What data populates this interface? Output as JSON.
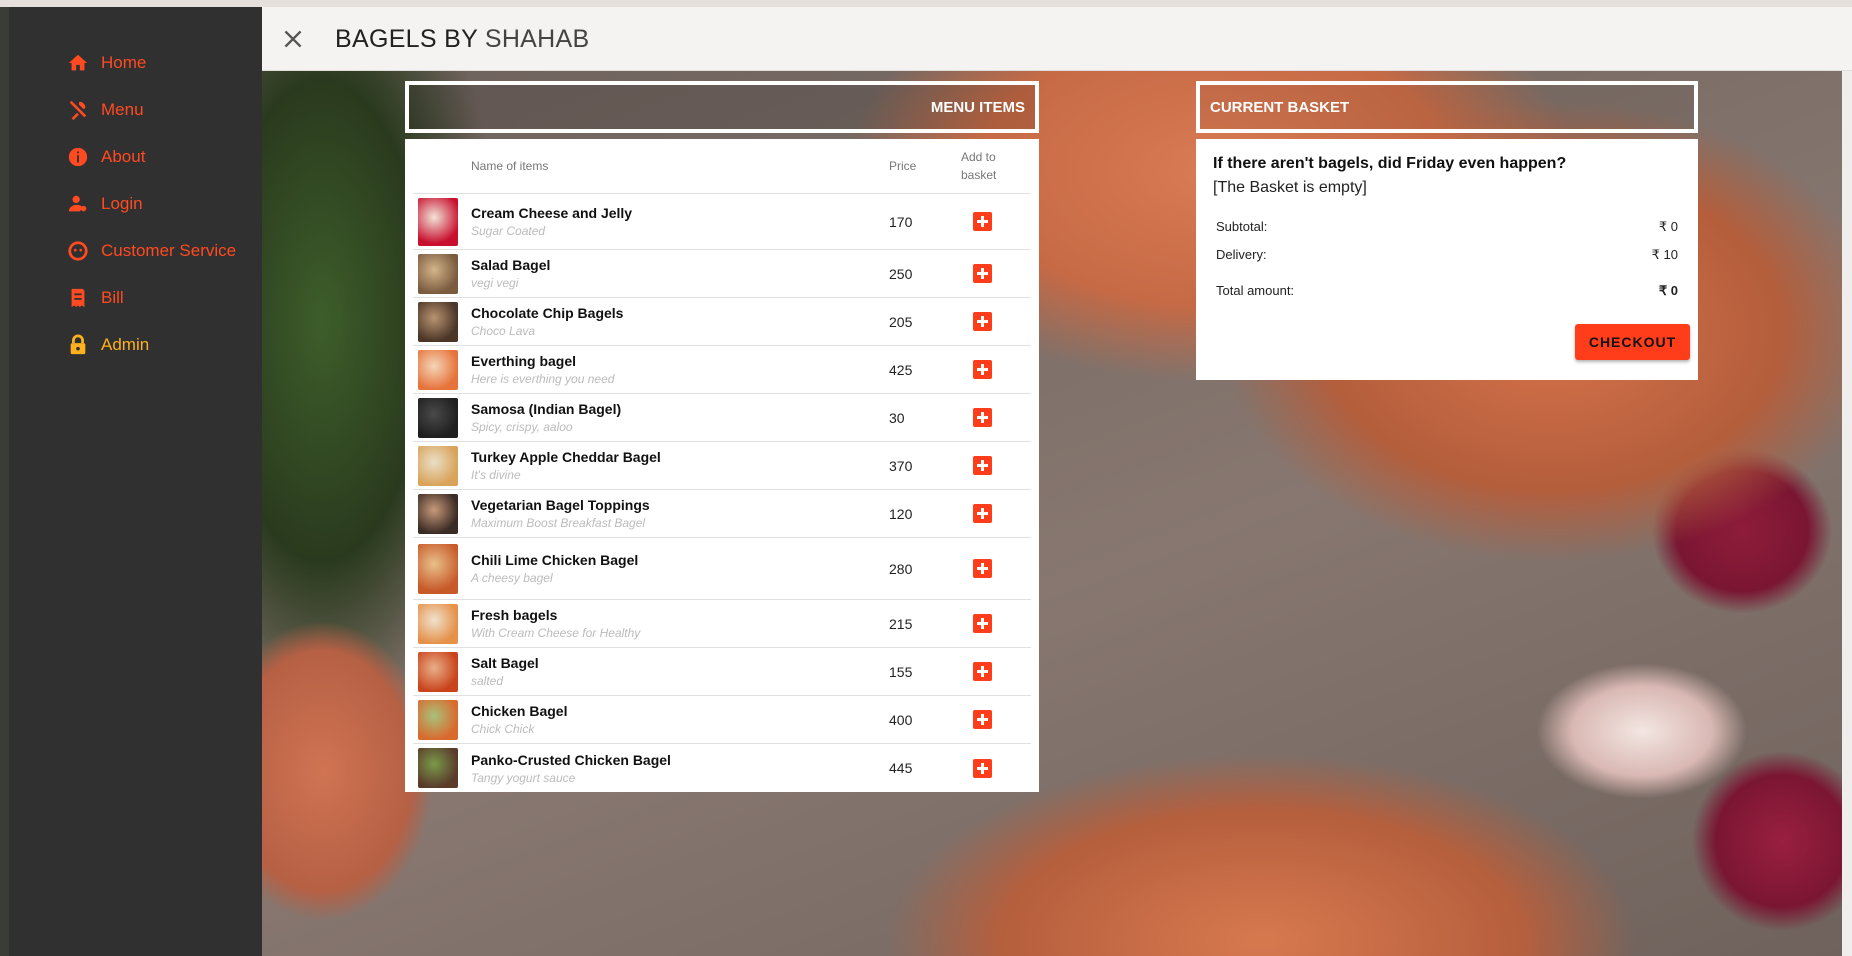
{
  "brand": {
    "part1": "BAGELS BY",
    "part2": "SHAHAB"
  },
  "nav": [
    {
      "label": "Home",
      "icon": "home-icon"
    },
    {
      "label": "Menu",
      "icon": "utensils-icon"
    },
    {
      "label": "About",
      "icon": "info-icon"
    },
    {
      "label": "Login",
      "icon": "user-icon"
    },
    {
      "label": "Customer Service",
      "icon": "headset-icon"
    },
    {
      "label": "Bill",
      "icon": "receipt-icon"
    },
    {
      "label": "Admin",
      "icon": "lock-icon"
    }
  ],
  "menu": {
    "header": "MENU ITEMS",
    "columns": {
      "name": "Name of items",
      "price": "Price",
      "add": "Add to basket"
    },
    "items": [
      {
        "name": "Cream Cheese and Jelly",
        "desc": "Sugar Coated",
        "price": "170"
      },
      {
        "name": "Salad Bagel",
        "desc": "vegi vegi",
        "price": "250"
      },
      {
        "name": "Chocolate Chip Bagels",
        "desc": "Choco Lava",
        "price": "205"
      },
      {
        "name": "Everthing bagel",
        "desc": "Here is everthing you need",
        "price": "425"
      },
      {
        "name": "Samosa (Indian Bagel)",
        "desc": "Spicy, crispy, aaloo",
        "price": "30"
      },
      {
        "name": "Turkey Apple Cheddar Bagel",
        "desc": "It's divine",
        "price": "370"
      },
      {
        "name": "Vegetarian Bagel Toppings",
        "desc": "Maximum Boost Breakfast Bagel",
        "price": "120"
      },
      {
        "name": "Chili Lime Chicken Bagel",
        "desc": "A cheesy bagel",
        "price": "280"
      },
      {
        "name": "Fresh bagels",
        "desc": "With Cream Cheese for Healthy",
        "price": "215"
      },
      {
        "name": "Salt Bagel",
        "desc": "salted",
        "price": "155"
      },
      {
        "name": "Chicken Bagel",
        "desc": "Chick Chick",
        "price": "400"
      },
      {
        "name": "Panko-Crusted Chicken Bagel",
        "desc": "Tangy yogurt sauce",
        "price": "445"
      }
    ]
  },
  "basket": {
    "header": "CURRENT BASKET",
    "tagline": "If there aren't bagels, did Friday even happen?",
    "empty_text": "[The Basket is empty]",
    "subtotal_label": "Subtotal:",
    "subtotal_value": "₹ 0",
    "delivery_label": "Delivery:",
    "delivery_value": "₹ 10",
    "total_label": "Total amount:",
    "total_value": "₹ 0",
    "checkout_label": "CHECKOUT"
  },
  "colors": {
    "accent": "#ff4a22",
    "admin": "#ffb01f",
    "sidebar": "#303030",
    "add_button": "#ff3d1a"
  }
}
